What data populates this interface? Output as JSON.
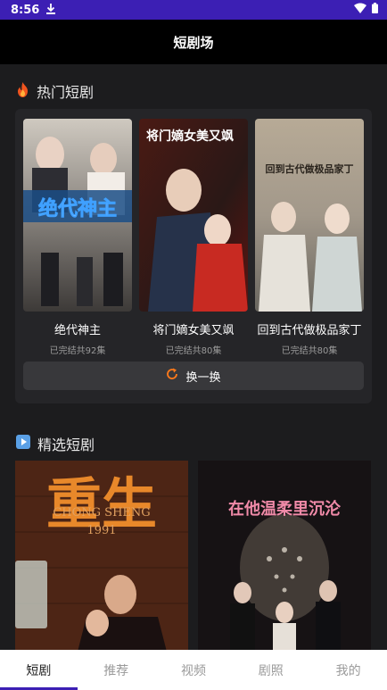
{
  "status_bar": {
    "time": "8:56"
  },
  "app_bar": {
    "title": "短剧场"
  },
  "hot_section": {
    "title": "热门短剧",
    "dramas": [
      {
        "name": "绝代神主",
        "status": "已完结共92集",
        "poster_text": "绝代神主"
      },
      {
        "name": "将门嫡女美又飒",
        "status": "已完结共80集",
        "poster_text": "将门嫡女美又飒"
      },
      {
        "name": "回到古代做极品家丁",
        "status": "已完结共80集",
        "poster_text": "回到古代做极品家丁"
      }
    ],
    "swap_label": "换一换"
  },
  "featured_section": {
    "title": "精选短剧",
    "posters": [
      {
        "poster_text": "重生",
        "poster_sub": "CHONG SHENG",
        "poster_year": "1991"
      },
      {
        "poster_text": "在他温柔里沉沦"
      }
    ]
  },
  "tabs": [
    {
      "label": "短剧",
      "active": true
    },
    {
      "label": "推荐",
      "active": false
    },
    {
      "label": "视频",
      "active": false
    },
    {
      "label": "剧照",
      "active": false
    },
    {
      "label": "我的",
      "active": false
    }
  ],
  "colors": {
    "accent": "#3c1fb4",
    "swap_icon": "#ff7a1a"
  }
}
